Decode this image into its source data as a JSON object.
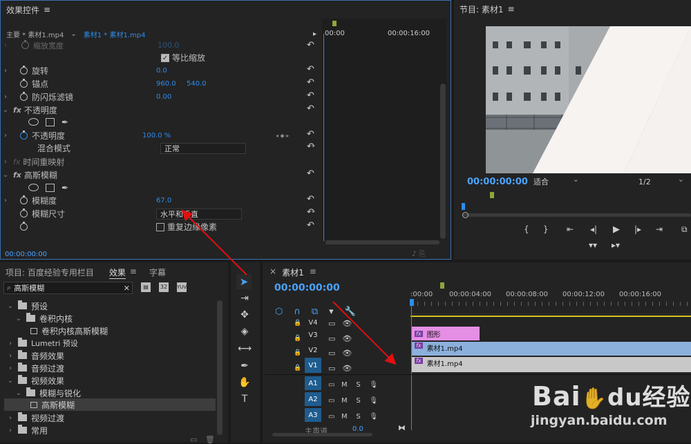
{
  "effect_controls": {
    "title": "效果控件",
    "source_label": "主要 * 素材1.mp4",
    "sequence_label": "素材1 * 素材1.mp4",
    "ruler_start": "00:00",
    "ruler_end": "00:00:16:00",
    "scale_faded_label": "缩放宽度",
    "scale_faded_value": "100.0",
    "uniform_scale_label": "等比缩放",
    "rotation_label": "旋转",
    "rotation_value": "0.0",
    "anchor_label": "锚点",
    "anchor_x": "960.0",
    "anchor_y": "540.0",
    "flicker_label": "防闪烁滤镜",
    "flicker_value": "0.00",
    "opacity_group": "不透明度",
    "opacity_label": "不透明度",
    "opacity_value": "100.0 %",
    "blend_label": "混合模式",
    "blend_value": "正常",
    "time_remap_label": "时间重映射",
    "gauss_group": "高斯模糊",
    "blurriness_label": "模糊度",
    "blurriness_value": "67.0",
    "blur_dim_label": "模糊尺寸",
    "blur_dim_value": "水平和垂直",
    "repeat_edge_label": "重复边缘像素",
    "timecode": "00:00:00:00"
  },
  "program": {
    "title": "节目: 素材1",
    "timecode": "00:00:00:00",
    "fit_value": "适合",
    "res_value": "1/2"
  },
  "project": {
    "title": "项目: 百度经验专用栏目",
    "tab_effects": "效果",
    "tab_captions": "字幕",
    "search_value": "高斯模糊",
    "tree": [
      {
        "label": "预设"
      },
      {
        "label": "卷积内核"
      },
      {
        "label": "卷积内核高斯模糊"
      },
      {
        "label": "Lumetri 预设"
      },
      {
        "label": "音频效果"
      },
      {
        "label": "音频过渡"
      },
      {
        "label": "视频效果"
      },
      {
        "label": "模糊与锐化"
      },
      {
        "label": "高斯模糊"
      },
      {
        "label": "视频过渡"
      },
      {
        "label": "常用"
      }
    ]
  },
  "timeline": {
    "tab": "素材1",
    "timecode": "00:00:00:00",
    "ruler": ":00:00",
    "ruler_labels": [
      "00:00:04:00",
      "00:00:08:00",
      "00:00:12:00",
      "00:00:16:00"
    ],
    "tracks": [
      "V4",
      "V3",
      "V2",
      "V1",
      "A1",
      "A2",
      "A3"
    ],
    "master_label": "主声道",
    "master_value": "0.0",
    "clip_graphic": "图形",
    "clip_v2": "素材1.mp4",
    "clip_v1": "素材1.mp4"
  },
  "watermark": {
    "brand": "Bai",
    "brand_cn": "经验",
    "url": "jingyan.baidu.com"
  },
  "colors": {
    "accent": "#2d8ceb",
    "clip_graphic": "#e48ee4",
    "clip_v2": "#8cb0dc",
    "clip_v1": "#c8c8c8",
    "annotation_arrow": "#e01010"
  }
}
